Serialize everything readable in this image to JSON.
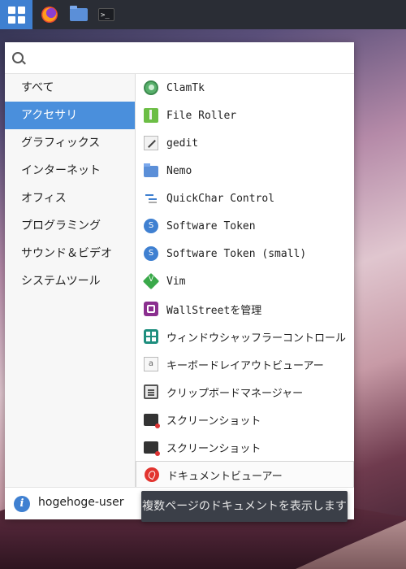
{
  "taskbar": {
    "items": [
      {
        "name": "apps-menu",
        "icon": "app-grid-icon"
      },
      {
        "name": "firefox",
        "icon": "firefox-icon"
      },
      {
        "name": "files",
        "icon": "folder-icon"
      },
      {
        "name": "terminal",
        "icon": "terminal-icon",
        "glyph": ">_"
      }
    ]
  },
  "search": {
    "placeholder": "",
    "value": "",
    "icon": "search-icon"
  },
  "categories": [
    {
      "label": "すべて"
    },
    {
      "label": "アクセサリ",
      "active": true
    },
    {
      "label": "グラフィックス"
    },
    {
      "label": "インターネット"
    },
    {
      "label": "オフィス"
    },
    {
      "label": "プログラミング"
    },
    {
      "label": "サウンド＆ビデオ"
    },
    {
      "label": "システムツール"
    }
  ],
  "apps": [
    {
      "label": "ClamTk",
      "icon": "clamtk-icon"
    },
    {
      "label": "File Roller",
      "icon": "archive-icon"
    },
    {
      "label": "gedit",
      "icon": "text-editor-icon"
    },
    {
      "label": "Nemo",
      "icon": "folder-icon"
    },
    {
      "label": "QuickChar Control",
      "icon": "quickchar-icon"
    },
    {
      "label": "Software Token",
      "icon": "token-icon",
      "glyph": "S"
    },
    {
      "label": "Software Token (small)",
      "icon": "token-icon",
      "glyph": "S"
    },
    {
      "label": "Vim",
      "icon": "vim-icon"
    },
    {
      "label": "WallStreetを管理",
      "icon": "wallpaper-icon"
    },
    {
      "label": "ウィンドウシャッフラーコントロール",
      "icon": "window-shuffler-icon"
    },
    {
      "label": "キーボードレイアウトビューアー",
      "icon": "keyboard-layout-icon",
      "glyph": "a"
    },
    {
      "label": "クリップボードマネージャー",
      "icon": "clipboard-icon"
    },
    {
      "label": "スクリーンショット",
      "icon": "screenshot-icon"
    },
    {
      "label": "スクリーンショット",
      "icon": "screenshot-icon"
    },
    {
      "label": "ドキュメントビューアー",
      "icon": "document-viewer-icon",
      "highlighted": true
    }
  ],
  "footer": {
    "user_name": "hogehoge-user",
    "user_icon_glyph": "i"
  },
  "tooltip": {
    "text": "複数ページのドキュメントを表示します"
  },
  "colors": {
    "accent": "#4a8fdc",
    "taskbar": "#2a2d35",
    "tooltip_bg": "#3b3f48"
  }
}
